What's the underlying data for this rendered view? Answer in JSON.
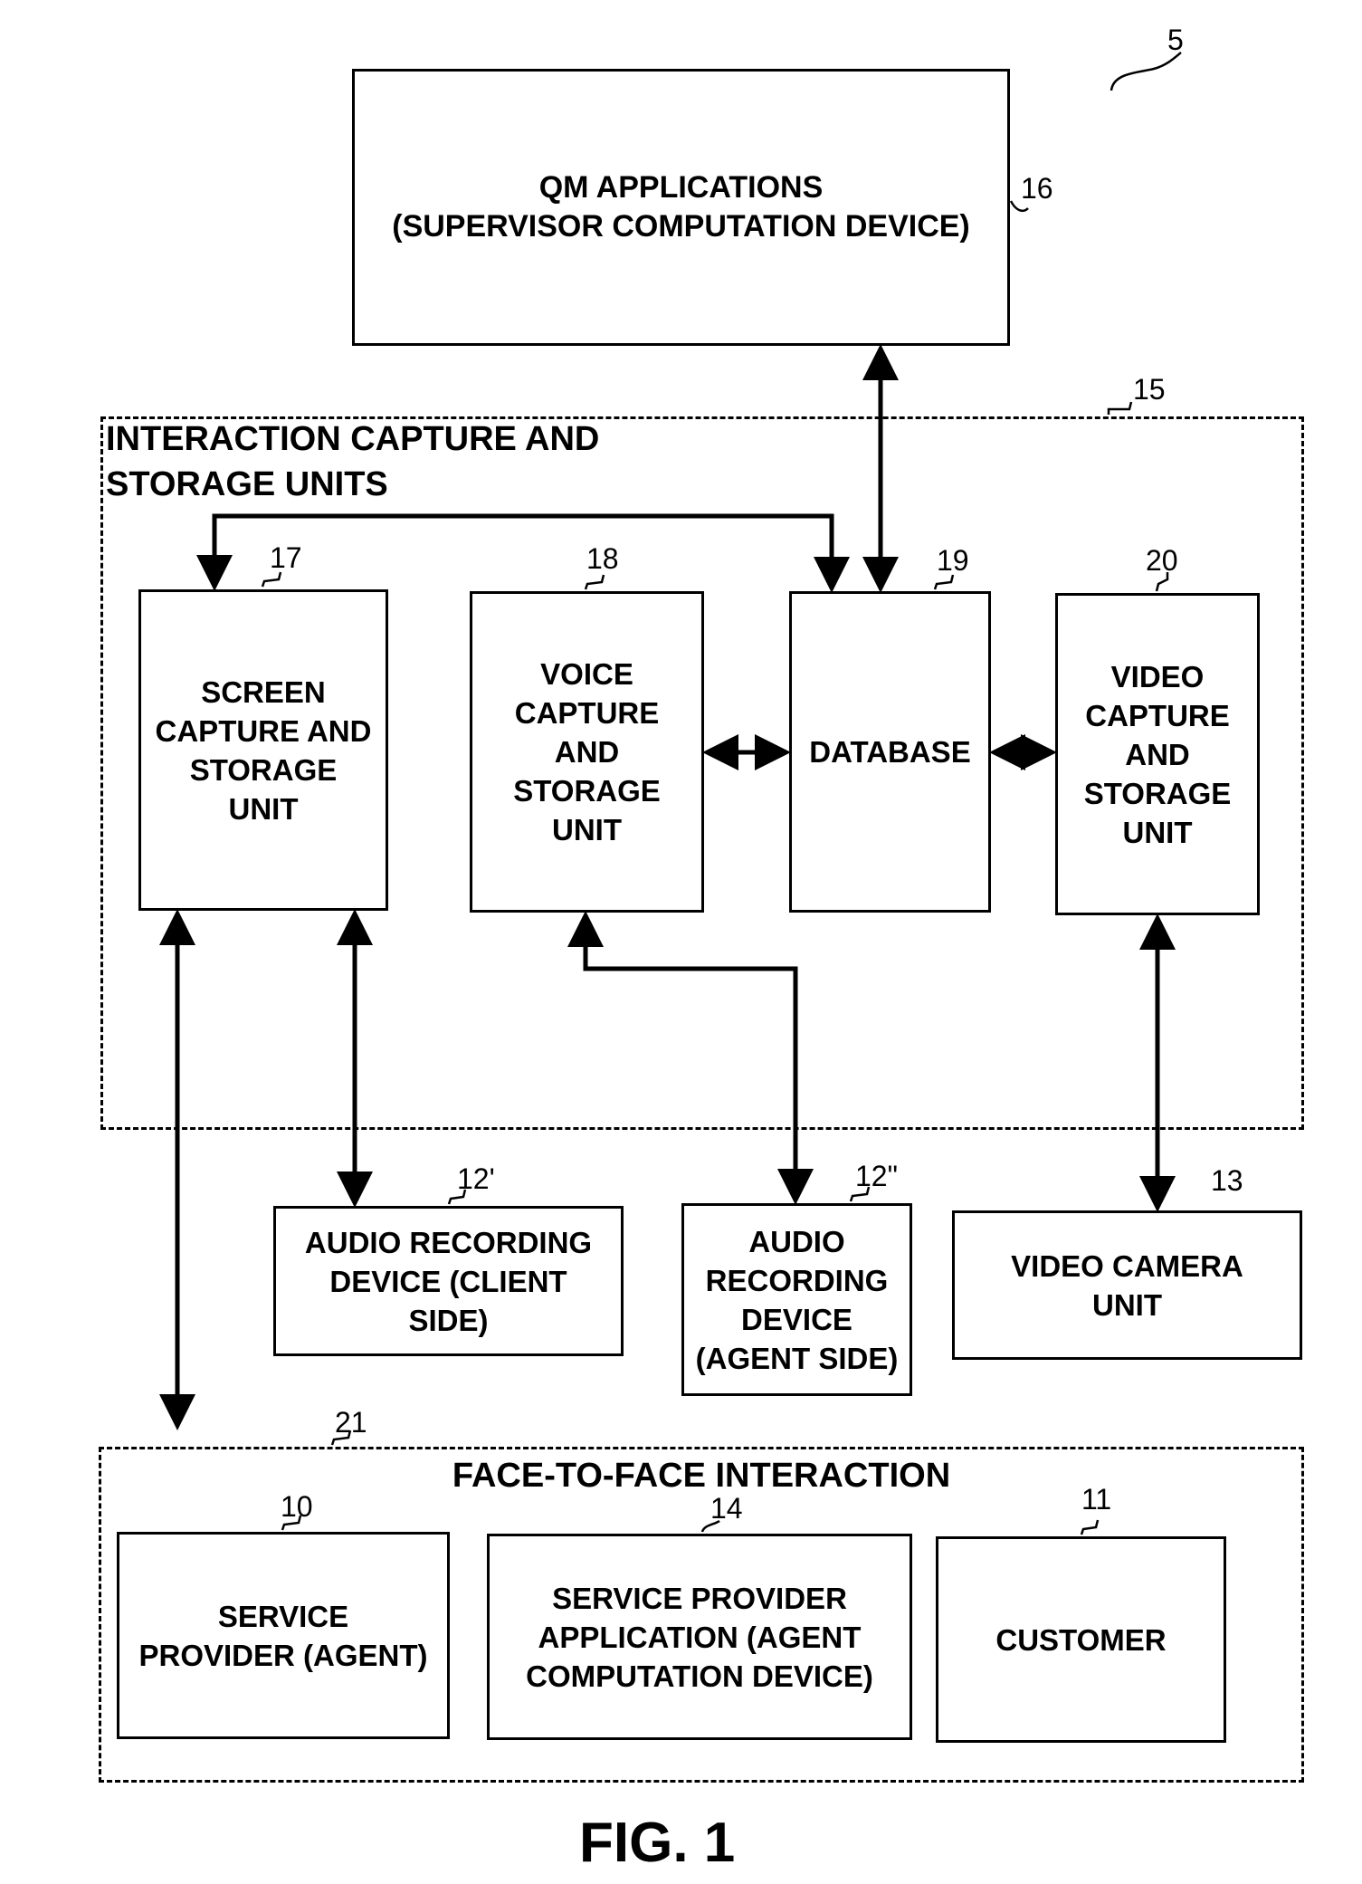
{
  "figure": {
    "caption": "FIG. 1",
    "system_ref": "5"
  },
  "nodes": {
    "qm": {
      "label": "QM APPLICATIONS\n(SUPERVISOR COMPUTATION DEVICE)",
      "ref": "16"
    },
    "capture_group": {
      "label": "INTERACTION CAPTURE AND\nSTORAGE UNITS",
      "ref": "15"
    },
    "screen": {
      "label": "SCREEN\nCAPTURE AND\nSTORAGE\nUNIT",
      "ref": "17"
    },
    "voice": {
      "label": "VOICE\nCAPTURE\nAND\nSTORAGE\nUNIT",
      "ref": "18"
    },
    "database": {
      "label": "DATABASE",
      "ref": "19"
    },
    "video": {
      "label": "VIDEO\nCAPTURE\nAND\nSTORAGE\nUNIT",
      "ref": "20"
    },
    "audio_client": {
      "label": "AUDIO RECORDING\nDEVICE (CLIENT\nSIDE)",
      "ref": "12'"
    },
    "audio_agent": {
      "label": "AUDIO\nRECORDING\nDEVICE\n(AGENT SIDE)",
      "ref": "12\""
    },
    "camera": {
      "label": "VIDEO CAMERA\nUNIT",
      "ref": "13"
    },
    "f2f_group": {
      "label": "FACE-TO-FACE INTERACTION",
      "ref": "21"
    },
    "agent": {
      "label": "SERVICE\nPROVIDER (AGENT)",
      "ref": "10"
    },
    "agent_app": {
      "label": "SERVICE PROVIDER\nAPPLICATION (AGENT\nCOMPUTATION DEVICE)",
      "ref": "14"
    },
    "customer": {
      "label": "CUSTOMER",
      "ref": "11"
    }
  },
  "connections": [
    {
      "from": "qm",
      "to": "database",
      "type": "bidirectional"
    },
    {
      "from": "database",
      "to": "screen",
      "type": "bidirectional"
    },
    {
      "from": "voice",
      "to": "database",
      "type": "bidirectional"
    },
    {
      "from": "database",
      "to": "video",
      "type": "bidirectional"
    },
    {
      "from": "screen",
      "to": "f2f_group",
      "type": "bidirectional"
    },
    {
      "from": "screen",
      "to": "audio_client",
      "type": "bidirectional"
    },
    {
      "from": "voice",
      "to": "audio_agent",
      "type": "bidirectional"
    },
    {
      "from": "video",
      "to": "camera",
      "type": "bidirectional"
    }
  ]
}
